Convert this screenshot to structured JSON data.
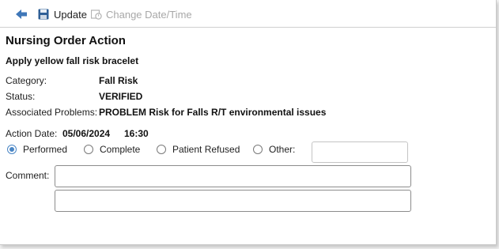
{
  "toolbar": {
    "back_icon": "back-arrow-icon",
    "update_icon": "save-disk-icon",
    "update_label": "Update",
    "change_icon": "calendar-clock-icon",
    "change_label": "Change Date/Time"
  },
  "page": {
    "title": "Nursing Order Action",
    "order_name": "Apply yellow fall risk bracelet"
  },
  "details": {
    "category_label": "Category:",
    "category_value": "Fall Risk",
    "status_label": "Status:",
    "status_value": "VERIFIED",
    "problems_label": "Associated Problems:",
    "problems_value": "PROBLEM Risk for Falls R/T environmental issues"
  },
  "action": {
    "date_label": "Action Date:",
    "date_value": "05/06/2024",
    "time_value": "16:30"
  },
  "options": {
    "performed": "Performed",
    "complete": "Complete",
    "refused": "Patient Refused",
    "other": "Other:",
    "selected": "Performed",
    "other_value": ""
  },
  "comment": {
    "label": "Comment:",
    "line1": "",
    "line2": ""
  },
  "colors": {
    "accent": "#4a86c5",
    "disabled_text": "#a8a8a8"
  }
}
